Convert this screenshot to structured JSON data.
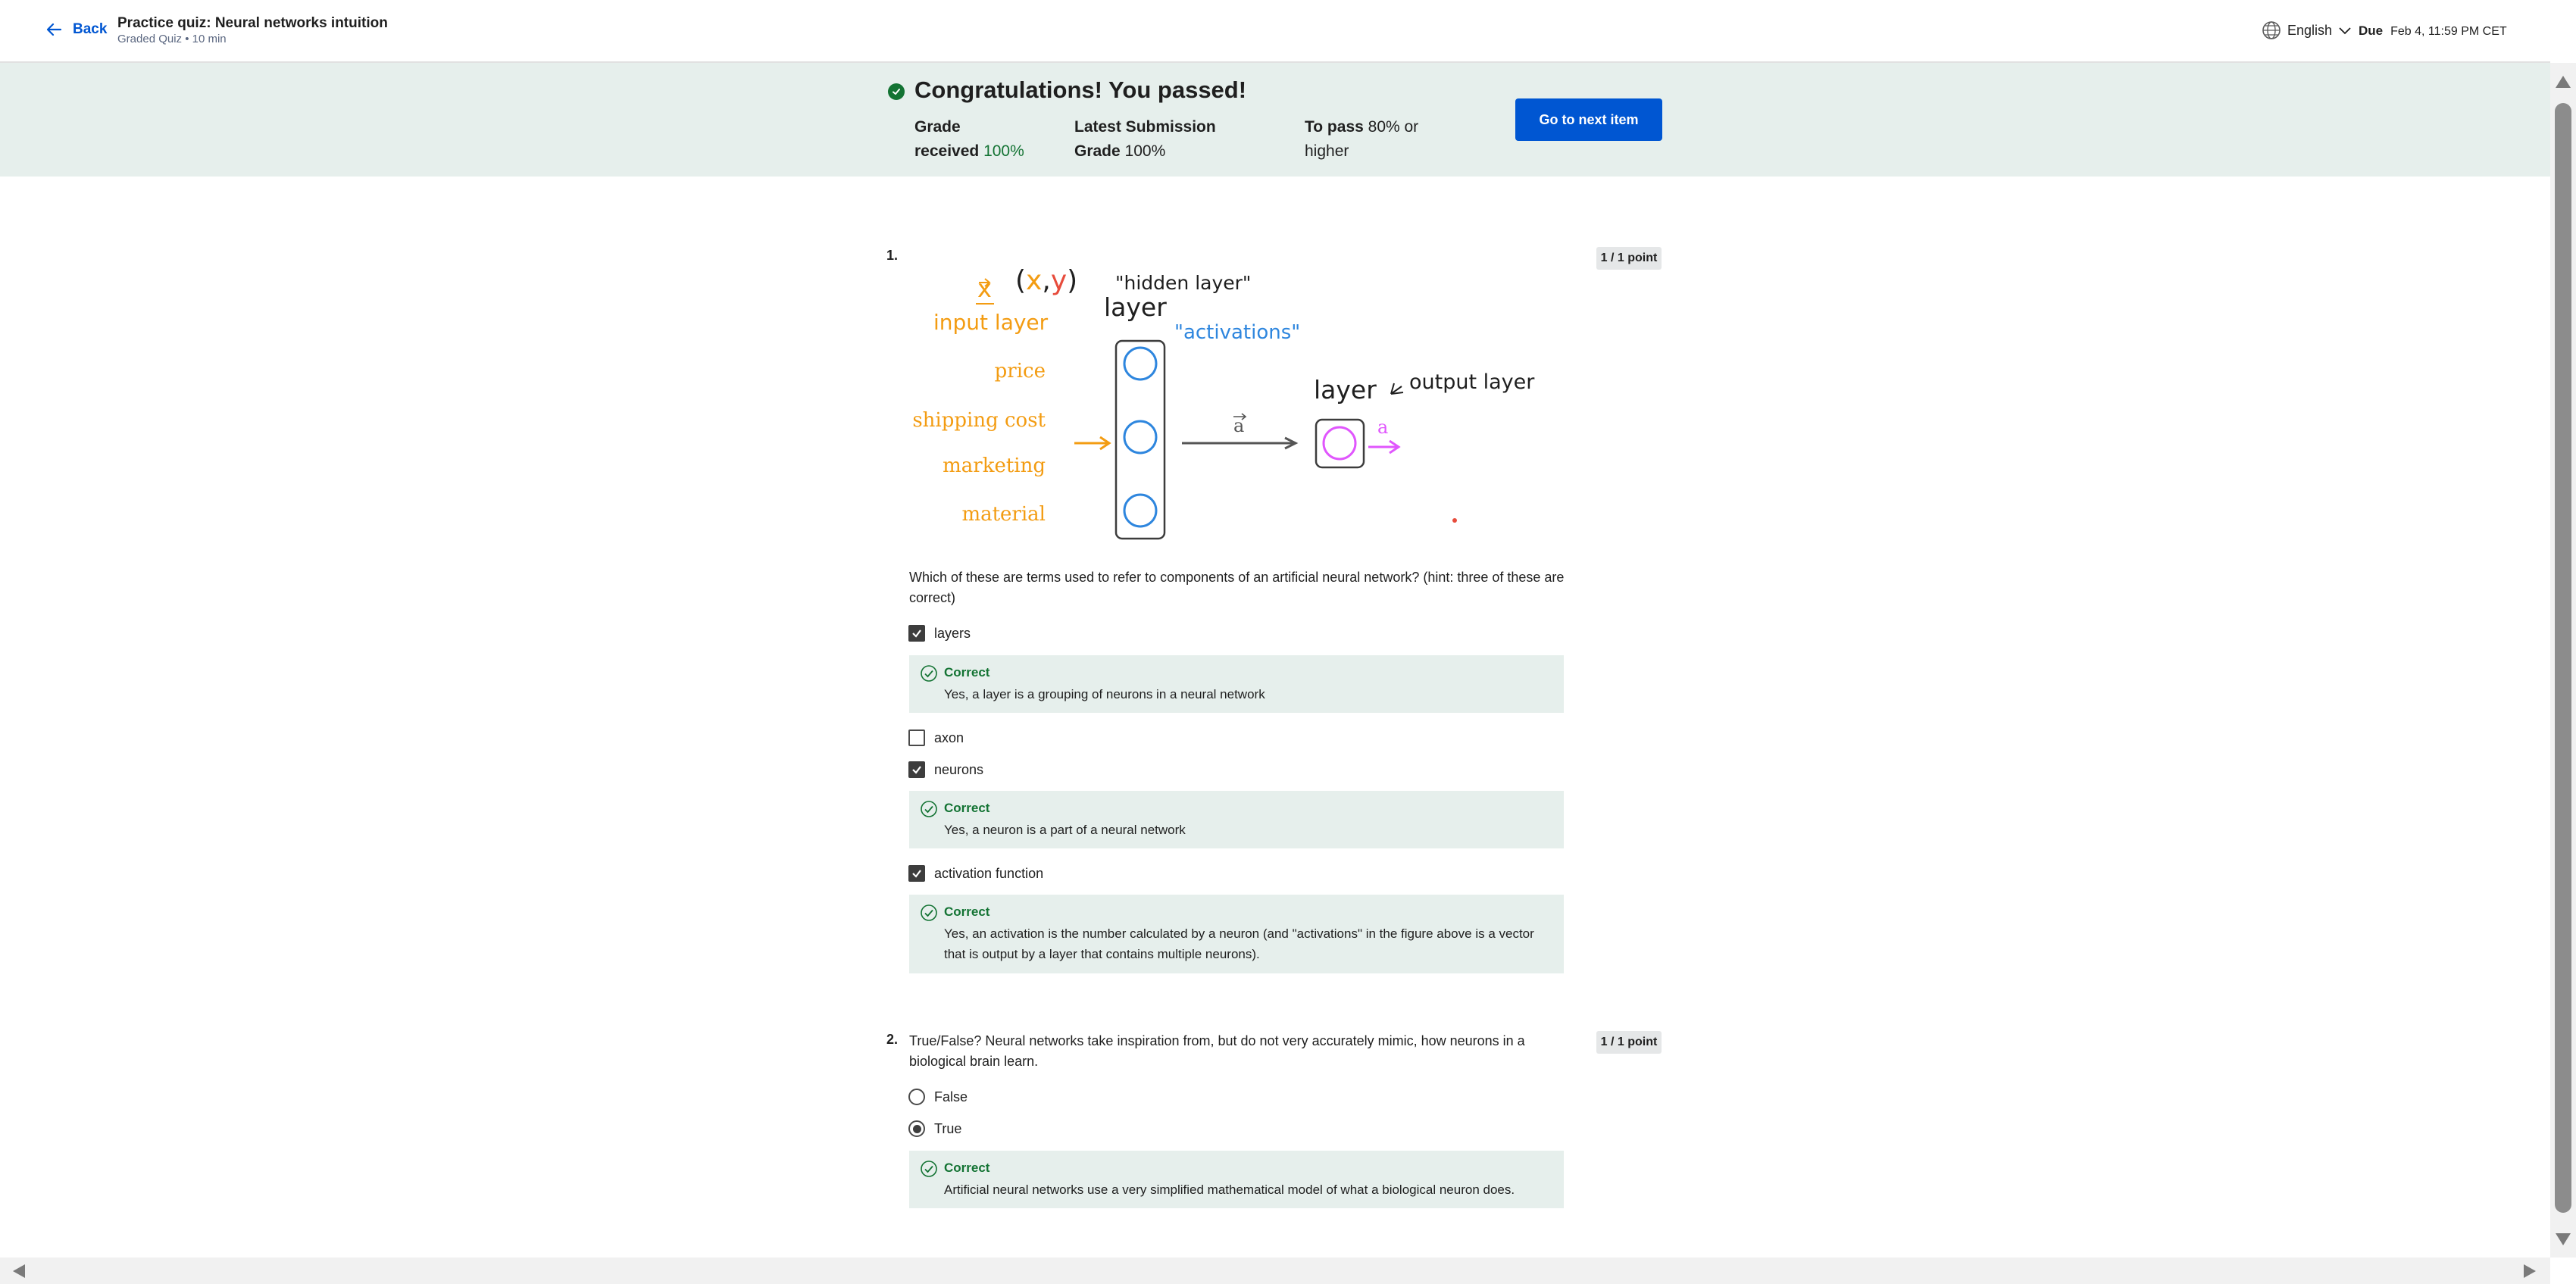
{
  "header": {
    "back_label": "Back",
    "title": "Practice quiz: Neural networks intuition",
    "subtitle": "Graded Quiz • 10 min",
    "language": "English",
    "due_label": "Due",
    "due_value": "Feb 4, 11:59 PM CET"
  },
  "banner": {
    "title": "Congratulations! You passed!",
    "grade_label_1": "Grade",
    "grade_label_2": "received",
    "grade_value": "100%",
    "latest_label_1": "Latest Submission",
    "latest_label_2": "Grade",
    "latest_value": "100%",
    "pass_label": "To pass",
    "pass_value_1": "80% or",
    "pass_value_2": "higher",
    "next_button": "Go to next item"
  },
  "q1": {
    "number": "1.",
    "points": "1 / 1 point",
    "text": "Which of these are terms used to refer to components of an artificial neural network? (hint: three of these are correct)",
    "diagram": {
      "x_label": "x",
      "pair_label": "(x,y)",
      "hidden_label": "\"hidden layer\"",
      "layer1_label": "layer",
      "input_label": "input layer",
      "activations_label": "\"activations\"",
      "layer2_label": "layer",
      "output_label": "output layer",
      "features": [
        "price",
        "shipping cost",
        "marketing",
        "material"
      ],
      "vector_label": "a",
      "out_label": "a"
    },
    "options": [
      {
        "label": "layers",
        "checked": true
      },
      {
        "label": "axon",
        "checked": false
      },
      {
        "label": "neurons",
        "checked": true
      },
      {
        "label": "activation function",
        "checked": true
      }
    ],
    "feedback": [
      {
        "title": "Correct",
        "text": "Yes, a layer is a grouping of neurons in a neural network"
      },
      {
        "title": "Correct",
        "text": "Yes, a neuron is a part of a neural network"
      },
      {
        "title": "Correct",
        "text": "Yes, an activation is the number calculated by a neuron (and \"activations\" in the figure above is a vector that is output by a layer that contains multiple neurons)."
      }
    ]
  },
  "q2": {
    "number": "2.",
    "points": "1 / 1 point",
    "text": "True/False? Neural networks take inspiration from, but do not very accurately mimic, how neurons in a biological brain learn.",
    "options": [
      {
        "label": "False",
        "checked": false
      },
      {
        "label": "True",
        "checked": true
      }
    ],
    "feedback": {
      "title": "Correct",
      "text": "Artificial neural networks use a very simplified mathematical model of what a biological neuron does."
    }
  },
  "colors": {
    "accent": "#0056d2",
    "success": "#137333",
    "banner_bg": "#e6efec",
    "orange": "#f39c12",
    "blue": "#2e86de",
    "magenta": "#e056fd"
  }
}
